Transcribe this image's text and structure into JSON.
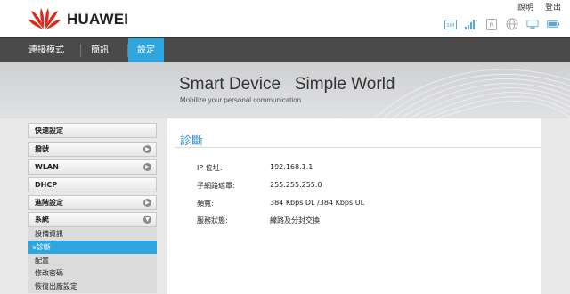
{
  "header": {
    "brand": "HUAWEI",
    "links": {
      "help": "說明",
      "logout": "登出"
    },
    "status_icons": [
      "sim-icon",
      "signal-icon",
      "roaming-icon",
      "globe-icon",
      "wifi-icon",
      "battery-icon"
    ]
  },
  "nav": {
    "tabs": [
      {
        "label": "連接模式",
        "active": false
      },
      {
        "label": "簡訊",
        "active": false
      },
      {
        "label": "設定",
        "active": true
      }
    ]
  },
  "banner": {
    "title": "Smart Device   Simple World",
    "subtitle": "Mobilize your personal communication"
  },
  "sidebar": {
    "menus": [
      {
        "label": "快速設定",
        "arrow": false
      },
      {
        "label": "撥號",
        "arrow": true
      },
      {
        "label": "WLAN",
        "arrow": true
      },
      {
        "label": "DHCP",
        "arrow": false
      },
      {
        "label": "進階設定",
        "arrow": true
      },
      {
        "label": "系統",
        "arrow": true
      }
    ],
    "submenus": [
      {
        "label": "設備資訊",
        "active": false
      },
      {
        "label": "»診斷",
        "active": true
      },
      {
        "label": "配置",
        "active": false
      },
      {
        "label": "修改密碼",
        "active": false
      },
      {
        "label": "恢復出廠設定",
        "active": false
      }
    ]
  },
  "content": {
    "title": "診斷",
    "rows": [
      {
        "label": "IP 位址:",
        "value": "192.168.1.1"
      },
      {
        "label": "子網路遮罩:",
        "value": "255.255.255.0"
      },
      {
        "label": "頻寬:",
        "value": "384 Kbps DL /384 Kbps UL"
      },
      {
        "label": "服務狀態:",
        "value": "線路及分封交換"
      }
    ]
  },
  "colors": {
    "accent": "#2ea7e0",
    "brand_red": "#e1261c",
    "nav_bg": "#4a4a4a",
    "title_blue": "#2a8fcf"
  }
}
